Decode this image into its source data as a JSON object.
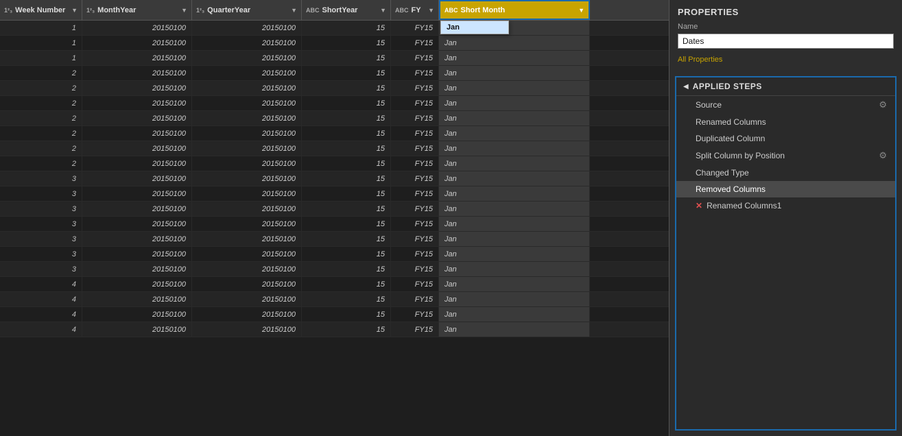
{
  "table": {
    "columns": [
      {
        "id": "week-number",
        "label": "Week Number",
        "type": "123",
        "type_label": "1²₃"
      },
      {
        "id": "month-year",
        "label": "MonthYear",
        "type": "123",
        "type_label": "1²₃"
      },
      {
        "id": "quarter-year",
        "label": "QuarterYear",
        "type": "123",
        "type_label": "1²₃"
      },
      {
        "id": "short-year",
        "label": "ShortYear",
        "type": "ABC",
        "type_label": "ABC"
      },
      {
        "id": "fy",
        "label": "FY",
        "type": "ABC",
        "type_label": "ABC"
      },
      {
        "id": "short-month",
        "label": "Short Month",
        "type": "ABC",
        "type_label": "ABC"
      }
    ],
    "rows": [
      {
        "week": "1",
        "monthYear": "20150100",
        "quarterYear": "20150100",
        "shortYear": "15",
        "fy": "FY15",
        "shortMonth": "Jan"
      },
      {
        "week": "1",
        "monthYear": "20150100",
        "quarterYear": "20150100",
        "shortYear": "15",
        "fy": "FY15",
        "shortMonth": "Jan"
      },
      {
        "week": "1",
        "monthYear": "20150100",
        "quarterYear": "20150100",
        "shortYear": "15",
        "fy": "FY15",
        "shortMonth": "Jan"
      },
      {
        "week": "2",
        "monthYear": "20150100",
        "quarterYear": "20150100",
        "shortYear": "15",
        "fy": "FY15",
        "shortMonth": "Jan"
      },
      {
        "week": "2",
        "monthYear": "20150100",
        "quarterYear": "20150100",
        "shortYear": "15",
        "fy": "FY15",
        "shortMonth": "Jan"
      },
      {
        "week": "2",
        "monthYear": "20150100",
        "quarterYear": "20150100",
        "shortYear": "15",
        "fy": "FY15",
        "shortMonth": "Jan"
      },
      {
        "week": "2",
        "monthYear": "20150100",
        "quarterYear": "20150100",
        "shortYear": "15",
        "fy": "FY15",
        "shortMonth": "Jan"
      },
      {
        "week": "2",
        "monthYear": "20150100",
        "quarterYear": "20150100",
        "shortYear": "15",
        "fy": "FY15",
        "shortMonth": "Jan"
      },
      {
        "week": "2",
        "monthYear": "20150100",
        "quarterYear": "20150100",
        "shortYear": "15",
        "fy": "FY15",
        "shortMonth": "Jan"
      },
      {
        "week": "2",
        "monthYear": "20150100",
        "quarterYear": "20150100",
        "shortYear": "15",
        "fy": "FY15",
        "shortMonth": "Jan"
      },
      {
        "week": "3",
        "monthYear": "20150100",
        "quarterYear": "20150100",
        "shortYear": "15",
        "fy": "FY15",
        "shortMonth": "Jan"
      },
      {
        "week": "3",
        "monthYear": "20150100",
        "quarterYear": "20150100",
        "shortYear": "15",
        "fy": "FY15",
        "shortMonth": "Jan"
      },
      {
        "week": "3",
        "monthYear": "20150100",
        "quarterYear": "20150100",
        "shortYear": "15",
        "fy": "FY15",
        "shortMonth": "Jan"
      },
      {
        "week": "3",
        "monthYear": "20150100",
        "quarterYear": "20150100",
        "shortYear": "15",
        "fy": "FY15",
        "shortMonth": "Jan"
      },
      {
        "week": "3",
        "monthYear": "20150100",
        "quarterYear": "20150100",
        "shortYear": "15",
        "fy": "FY15",
        "shortMonth": "Jan"
      },
      {
        "week": "3",
        "monthYear": "20150100",
        "quarterYear": "20150100",
        "shortYear": "15",
        "fy": "FY15",
        "shortMonth": "Jan"
      },
      {
        "week": "3",
        "monthYear": "20150100",
        "quarterYear": "20150100",
        "shortYear": "15",
        "fy": "FY15",
        "shortMonth": "Jan"
      },
      {
        "week": "4",
        "monthYear": "20150100",
        "quarterYear": "20150100",
        "shortYear": "15",
        "fy": "FY15",
        "shortMonth": "Jan"
      },
      {
        "week": "4",
        "monthYear": "20150100",
        "quarterYear": "20150100",
        "shortYear": "15",
        "fy": "FY15",
        "shortMonth": "Jan"
      },
      {
        "week": "4",
        "monthYear": "20150100",
        "quarterYear": "20150100",
        "shortYear": "15",
        "fy": "FY15",
        "shortMonth": "Jan"
      },
      {
        "week": "4",
        "monthYear": "20150100",
        "quarterYear": "20150100",
        "shortYear": "15",
        "fy": "FY15",
        "shortMonth": "Jan"
      }
    ]
  },
  "properties": {
    "section_title": "PROPERTIES",
    "name_label": "Name",
    "name_value": "Dates",
    "all_properties_label": "All Properties"
  },
  "applied_steps": {
    "section_title": "APPLIED STEPS",
    "steps": [
      {
        "id": "source",
        "label": "Source",
        "has_gear": true,
        "is_active": false,
        "has_error": false
      },
      {
        "id": "renamed-columns",
        "label": "Renamed Columns",
        "has_gear": false,
        "is_active": false,
        "has_error": false
      },
      {
        "id": "duplicated-column",
        "label": "Duplicated Column",
        "has_gear": false,
        "is_active": false,
        "has_error": false
      },
      {
        "id": "split-column-position",
        "label": "Split Column by Position",
        "has_gear": true,
        "is_active": false,
        "has_error": false
      },
      {
        "id": "changed-type",
        "label": "Changed Type",
        "has_gear": false,
        "is_active": false,
        "has_error": false
      },
      {
        "id": "removed-columns",
        "label": "Removed Columns",
        "has_gear": false,
        "is_active": true,
        "has_error": false
      },
      {
        "id": "renamed-columns-1",
        "label": "Renamed Columns1",
        "has_gear": false,
        "is_active": false,
        "has_error": true
      }
    ]
  },
  "dropdown": {
    "visible": true,
    "item": "Jan"
  }
}
